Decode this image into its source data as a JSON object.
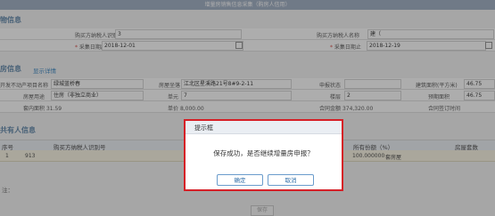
{
  "window": {
    "title": "增量房销售信息采集（购房人信用）"
  },
  "buyer_section": {
    "title": "物信息",
    "buyer_taxpayer_id_label": "购买方纳税人识别号",
    "buyer_taxpayer_id_value": "3",
    "buyer_taxpayer_name_label": "购买方纳税人名称",
    "buyer_taxpayer_name_value": "建（",
    "collect_date_start_label": "采集日期起",
    "collect_date_start_value": "2018-12-01",
    "collect_date_end_label": "采集日期止",
    "collect_date_end_value": "2018-12-19"
  },
  "property_section": {
    "title": "房信息",
    "link": "显示详情",
    "project_name_label": "开发不动产项目名称",
    "project_name_value": "绿城蓝桥春",
    "address_label": "房屋坐落",
    "address_value": "江北区星溪路21号8#9-2-11",
    "status_label": "申报状态",
    "area_label": "建筑面积(平方米)",
    "area_value": "46.75",
    "contract_area_label": "预期面积",
    "contract_area_value": "0",
    "usage_label": "房屋用途",
    "usage_value": "住房（非独立商业）",
    "unit_label": "单元",
    "unit_value": "7",
    "room_label": "楼层",
    "room_value": "2",
    "floor_label": "所在楼层",
    "floor_value": "8",
    "total_area_label": "套内面积",
    "total_area_value": "31.59",
    "price_label": "单价",
    "price_value": "8,000.00",
    "contract_amount_label": "合同金额",
    "contract_amount_value": "374,320.00",
    "contract_date_label": "合同签订时间"
  },
  "co_owner_section": {
    "title": "共有人信息",
    "headers": [
      "序号",
      "购买方纳税人识别号",
      "所有份额（%）",
      "房屋套数"
    ],
    "rows": [
      {
        "index": "1",
        "taxpayer_id": "913",
        "share": "100.000000",
        "house_count": "套房屋"
      }
    ]
  },
  "footnote": "注：",
  "save_button": "保存",
  "dialog": {
    "title": "提示框",
    "message": "保存成功，是否继续增量房申报？",
    "ok_label": "确定",
    "cancel_label": "取消"
  },
  "colors": {
    "accent_border": "#d61f26",
    "title_bar": "#a6b4c8",
    "section_title": "#6b8fb0"
  }
}
